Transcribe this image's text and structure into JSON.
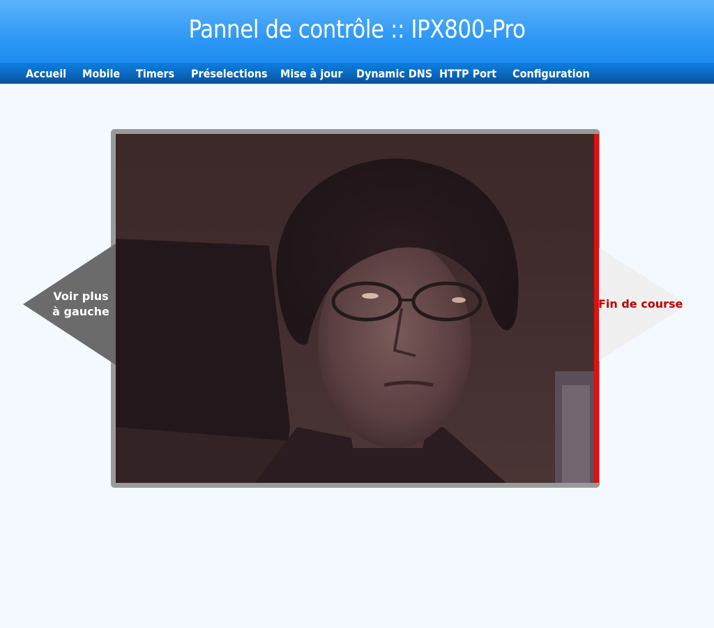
{
  "header": {
    "title": "Pannel de contrôle :: IPX800-Pro"
  },
  "nav": {
    "items": [
      {
        "label": "Accueil"
      },
      {
        "label": "Mobile"
      },
      {
        "label": "Timers"
      },
      {
        "label": "Préselections"
      },
      {
        "label": "Mise à jour"
      },
      {
        "label": "Dynamic DNS"
      },
      {
        "label": "HTTP Port"
      },
      {
        "label": "Configuration"
      }
    ]
  },
  "camera": {
    "left_arrow": {
      "line1": "Voir plus",
      "line2": "à gauche"
    },
    "right_arrow": {
      "label": "Fin de course"
    }
  },
  "colors": {
    "header_gradient_top": "#5db3fb",
    "nav_background": "#0a68bd",
    "page_background": "#f3f9fe",
    "limit_indicator": "#dd1111",
    "limit_text": "#c00000",
    "left_arrow_fill": "#6b6b6b",
    "right_arrow_fill": "#f0f0f0"
  },
  "icons": {
    "left_arrow": "left-arrow-icon",
    "right_arrow": "right-arrow-icon"
  }
}
